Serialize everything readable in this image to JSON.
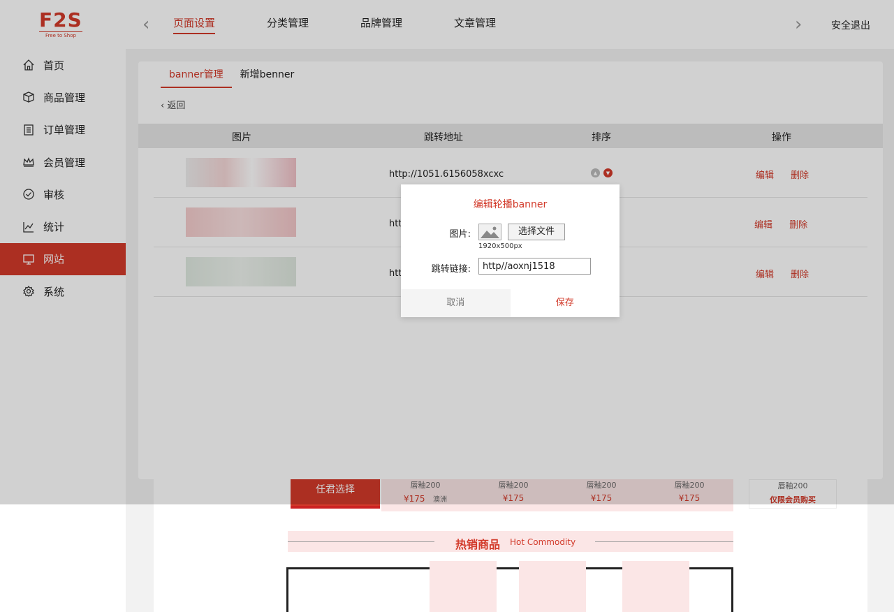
{
  "brand": {
    "logo_text": "F2S",
    "logo_sub": "Free to Shop",
    "color": "#d23a2a"
  },
  "topnav": {
    "items": [
      {
        "label": "页面设置",
        "active": true
      },
      {
        "label": "分类管理"
      },
      {
        "label": "品牌管理"
      },
      {
        "label": "文章管理"
      }
    ],
    "logout": "安全退出"
  },
  "sidebar": {
    "items": [
      {
        "label": "首页",
        "icon": "home-icon"
      },
      {
        "label": "商品管理",
        "icon": "box-icon"
      },
      {
        "label": "订单管理",
        "icon": "list-icon"
      },
      {
        "label": "会员管理",
        "icon": "crown-icon"
      },
      {
        "label": "审核",
        "icon": "check-circle-icon"
      },
      {
        "label": "统计",
        "icon": "chart-icon"
      },
      {
        "label": "网站",
        "icon": "monitor-icon",
        "active": true
      },
      {
        "label": "系统",
        "icon": "gear-icon"
      }
    ]
  },
  "subtabs": [
    {
      "label": "banner管理",
      "active": true
    },
    {
      "label": "新增benner"
    }
  ],
  "back_label": "返回",
  "table": {
    "headers": [
      "图片",
      "跳转地址",
      "排序",
      "操作"
    ],
    "rows": [
      {
        "url": "http://1051.6156058xcxc",
        "edit": "编辑",
        "delete": "删除"
      },
      {
        "url": "htt",
        "edit": "编辑",
        "delete": "删除"
      },
      {
        "url": "htt",
        "edit": "编辑",
        "delete": "删除"
      }
    ]
  },
  "lower": {
    "promo_button": "任君选择",
    "products": [
      {
        "sub": "唇釉200",
        "price": "¥175",
        "origin": "澳洲"
      },
      {
        "sub": "唇釉200",
        "price": "¥175"
      },
      {
        "sub": "唇釉200",
        "price": "¥175"
      },
      {
        "sub": "唇釉200",
        "price": "¥175"
      }
    ],
    "member": {
      "sub": "唇釉200",
      "label": "仅限会员购买"
    },
    "hot_title": "热销商品",
    "hot_en": "Hot Commodity"
  },
  "modal": {
    "title": "编辑轮播banner",
    "image_label": "图片:",
    "file_button": "选择文件",
    "size_hint": "1920x500px",
    "link_label": "跳转链接:",
    "link_value": "http//aoxnj1518",
    "cancel": "取消",
    "save": "保存"
  }
}
